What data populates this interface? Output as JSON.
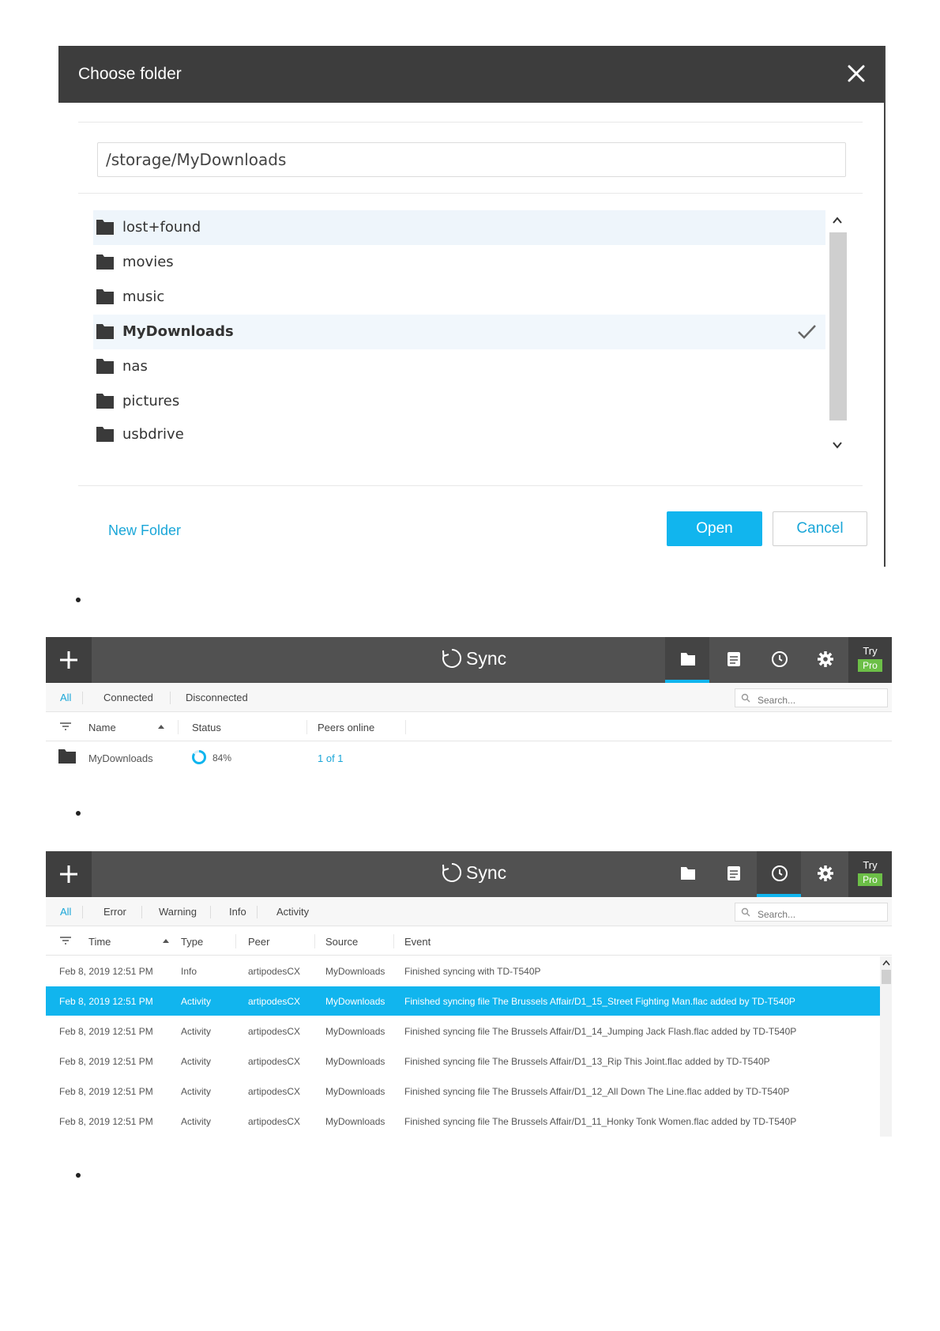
{
  "dialog": {
    "title": "Choose folder",
    "path_value": "/storage/MyDownloads",
    "folders": [
      {
        "name": "lost+found"
      },
      {
        "name": "movies"
      },
      {
        "name": "music"
      },
      {
        "name": "MyDownloads",
        "selected": true
      },
      {
        "name": "nas"
      },
      {
        "name": "pictures"
      },
      {
        "name": "usbdrive"
      }
    ],
    "new_folder_label": "New Folder",
    "open_label": "Open",
    "cancel_label": "Cancel"
  },
  "folders_view": {
    "brand": "Sync",
    "try_label": "Try",
    "pro_label": "Pro",
    "tabs": [
      "All",
      "Connected",
      "Disconnected"
    ],
    "search_placeholder": "Search...",
    "columns": {
      "name": "Name",
      "status": "Status",
      "peers": "Peers online"
    },
    "row": {
      "name": "MyDownloads",
      "status": "84%",
      "peers": "1 of 1",
      "progress_fraction": 0.84
    }
  },
  "history_view": {
    "brand": "Sync",
    "try_label": "Try",
    "pro_label": "Pro",
    "tabs": [
      "All",
      "Error",
      "Warning",
      "Info",
      "Activity"
    ],
    "search_placeholder": "Search...",
    "columns": {
      "time": "Time",
      "type": "Type",
      "peer": "Peer",
      "source": "Source",
      "event": "Event"
    },
    "rows": [
      {
        "time": "Feb 8, 2019 12:51 PM",
        "type": "Info",
        "peer": "artipodesCX",
        "source": "MyDownloads",
        "event": "Finished syncing with TD-T540P"
      },
      {
        "time": "Feb 8, 2019 12:51 PM",
        "type": "Activity",
        "peer": "artipodesCX",
        "source": "MyDownloads",
        "event": "Finished syncing file The Brussels Affair/D1_15_Street Fighting Man.flac added by TD-T540P",
        "selected": true
      },
      {
        "time": "Feb 8, 2019 12:51 PM",
        "type": "Activity",
        "peer": "artipodesCX",
        "source": "MyDownloads",
        "event": "Finished syncing file The Brussels Affair/D1_14_Jumping Jack Flash.flac added by TD-T540P"
      },
      {
        "time": "Feb 8, 2019 12:51 PM",
        "type": "Activity",
        "peer": "artipodesCX",
        "source": "MyDownloads",
        "event": "Finished syncing file The Brussels Affair/D1_13_Rip This Joint.flac added by TD-T540P"
      },
      {
        "time": "Feb 8, 2019 12:51 PM",
        "type": "Activity",
        "peer": "artipodesCX",
        "source": "MyDownloads",
        "event": "Finished syncing file The Brussels Affair/D1_12_All Down The Line.flac added by TD-T540P"
      },
      {
        "time": "Feb 8, 2019 12:51 PM",
        "type": "Activity",
        "peer": "artipodesCX",
        "source": "MyDownloads",
        "event": "Finished syncing file The Brussels Affair/D1_11_Honky Tonk Women.flac added by TD-T540P"
      }
    ]
  },
  "colors": {
    "accent": "#11b5ee",
    "topbar": "#515151",
    "pro_badge": "#6cbf47",
    "dialog_header": "#3d3d3d"
  }
}
